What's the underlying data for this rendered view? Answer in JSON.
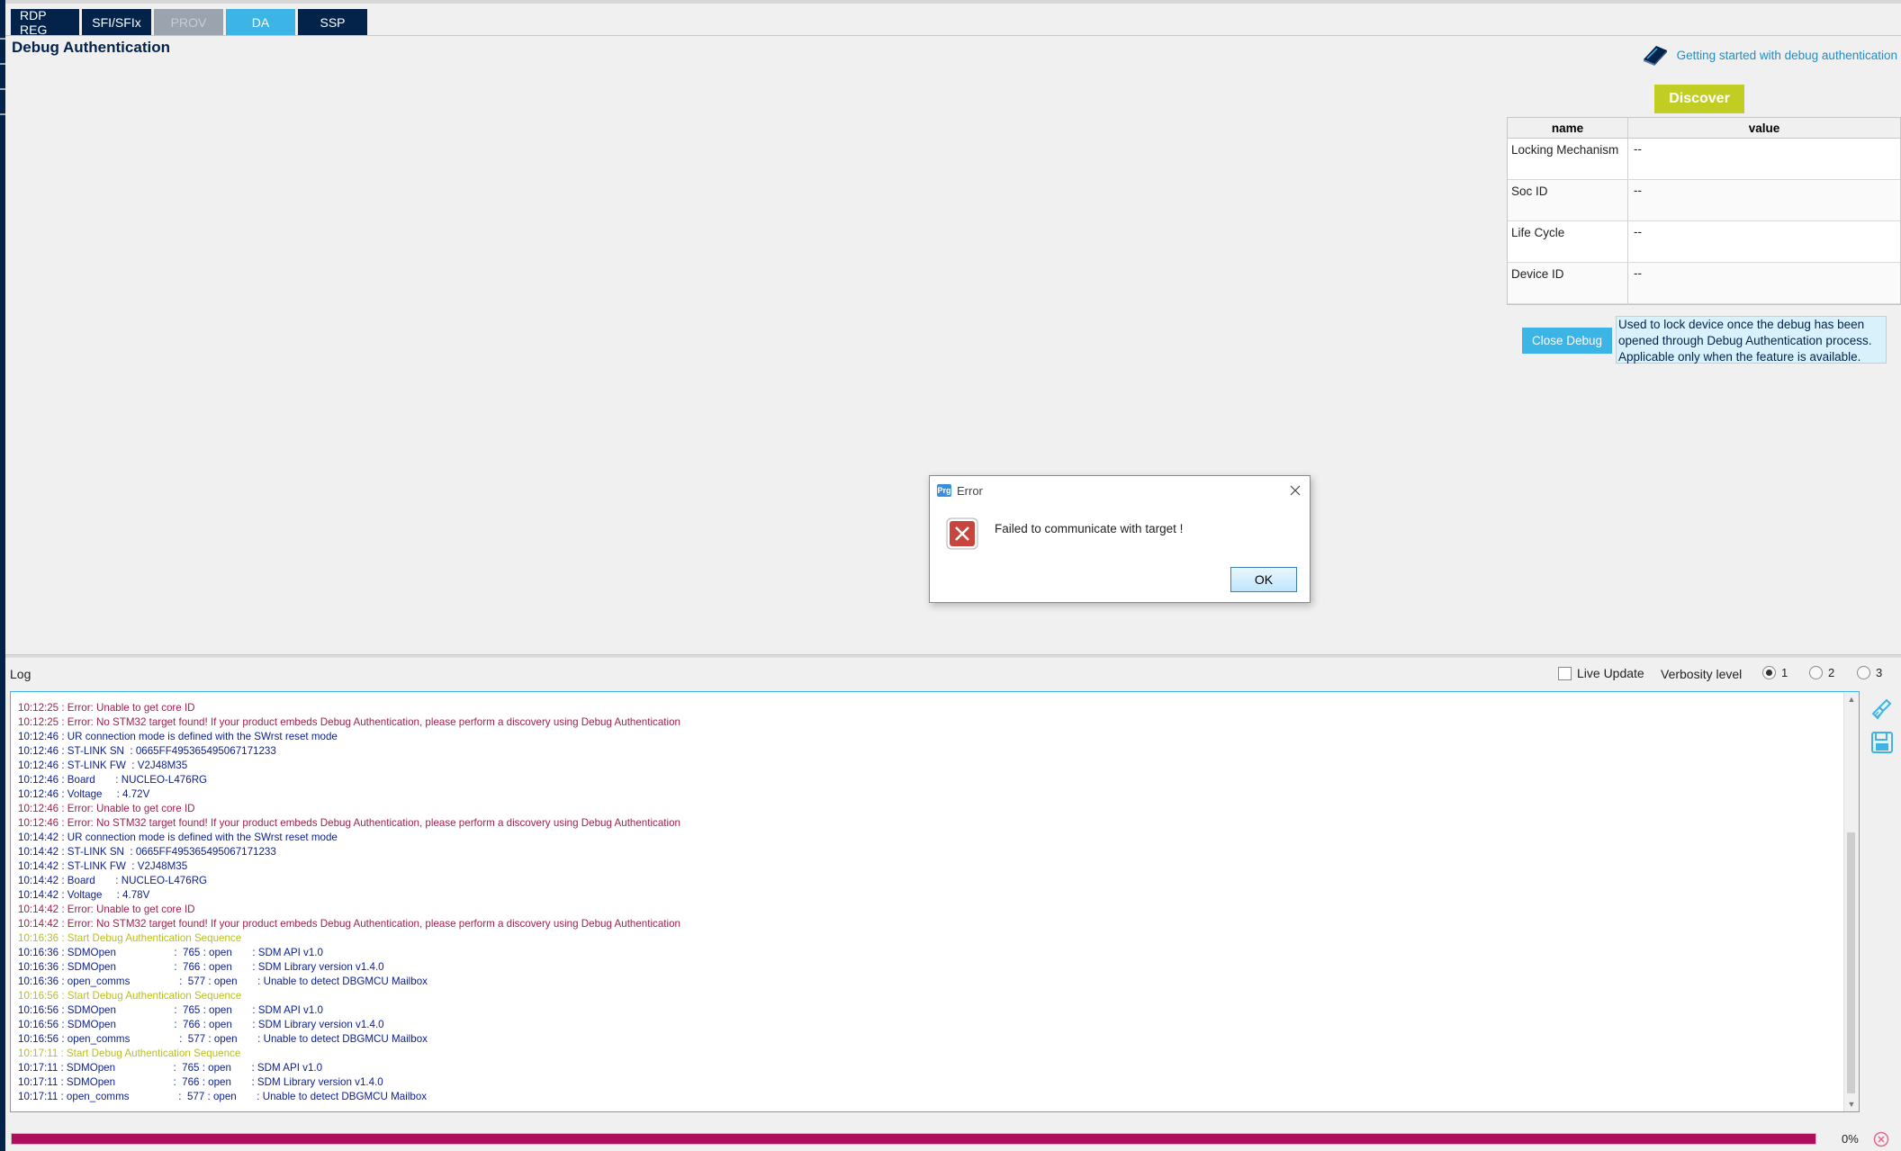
{
  "tabs": [
    {
      "label": "RDP REG"
    },
    {
      "label": "SFI/SFIx"
    },
    {
      "label": "PROV"
    },
    {
      "label": "DA"
    },
    {
      "label": "SSP"
    }
  ],
  "page": {
    "title": "Debug Authentication",
    "help_link": "Getting started with debug authentication",
    "discover_label": "Discover"
  },
  "properties_table": {
    "headers": [
      "name",
      "value"
    ],
    "rows": [
      {
        "name": "Locking Mechanism",
        "value": "--"
      },
      {
        "name": "Soc ID",
        "value": "--"
      },
      {
        "name": "Life Cycle",
        "value": "--"
      },
      {
        "name": "Device ID",
        "value": "--"
      }
    ]
  },
  "close_debug": {
    "label": "Close Debug",
    "tooltip": "Used to lock device once the debug has been opened through Debug Authentication process. Applicable only when the feature is available."
  },
  "dialog": {
    "app_icon": "Prg",
    "title": "Error",
    "message": "Failed to communicate with target !",
    "ok_label": "OK"
  },
  "log": {
    "label": "Log",
    "live_update_label": "Live Update",
    "live_update_checked": false,
    "verbosity_label": "Verbosity level",
    "verbosity_options": [
      "1",
      "2",
      "3"
    ],
    "verbosity_selected": "1",
    "lines": [
      {
        "t": "",
        "type": "clip"
      },
      {
        "t": "10:12:25 : Error: Unable to get core ID",
        "type": "error"
      },
      {
        "t": "10:12:25 : Error: No STM32 target found! If your product embeds Debug Authentication, please perform a discovery using Debug Authentication",
        "type": "error"
      },
      {
        "t": "10:12:46 : UR connection mode is defined with the SWrst reset mode",
        "type": "info"
      },
      {
        "t": "10:12:46 : ST-LINK SN  : 0665FF495365495067171233",
        "type": "info"
      },
      {
        "t": "10:12:46 : ST-LINK FW  : V2J48M35",
        "type": "info"
      },
      {
        "t": "10:12:46 : Board       : NUCLEO-L476RG",
        "type": "info"
      },
      {
        "t": "10:12:46 : Voltage     : 4.72V",
        "type": "info"
      },
      {
        "t": "10:12:46 : Error: Unable to get core ID",
        "type": "error"
      },
      {
        "t": "10:12:46 : Error: No STM32 target found! If your product embeds Debug Authentication, please perform a discovery using Debug Authentication",
        "type": "error"
      },
      {
        "t": "10:14:42 : UR connection mode is defined with the SWrst reset mode",
        "type": "info"
      },
      {
        "t": "10:14:42 : ST-LINK SN  : 0665FF495365495067171233",
        "type": "info"
      },
      {
        "t": "10:14:42 : ST-LINK FW  : V2J48M35",
        "type": "info"
      },
      {
        "t": "10:14:42 : Board       : NUCLEO-L476RG",
        "type": "info"
      },
      {
        "t": "10:14:42 : Voltage     : 4.78V",
        "type": "info"
      },
      {
        "t": "10:14:42 : Error: Unable to get core ID",
        "type": "error"
      },
      {
        "t": "10:14:42 : Error: No STM32 target found! If your product embeds Debug Authentication, please perform a discovery using Debug Authentication",
        "type": "error"
      },
      {
        "t": "10:16:36 : Start Debug Authentication Sequence",
        "type": "warn"
      },
      {
        "t": "10:16:36 : SDMOpen                    :  765 : open       : SDM API v1.0",
        "type": "info"
      },
      {
        "t": "10:16:36 : SDMOpen                    :  766 : open       : SDM Library version v1.4.0",
        "type": "info"
      },
      {
        "t": "10:16:36 : open_comms                 :  577 : open       : Unable to detect DBGMCU Mailbox",
        "type": "info"
      },
      {
        "t": "10:16:56 : Start Debug Authentication Sequence",
        "type": "warn"
      },
      {
        "t": "10:16:56 : SDMOpen                    :  765 : open       : SDM API v1.0",
        "type": "info"
      },
      {
        "t": "10:16:56 : SDMOpen                    :  766 : open       : SDM Library version v1.4.0",
        "type": "info"
      },
      {
        "t": "10:16:56 : open_comms                 :  577 : open       : Unable to detect DBGMCU Mailbox",
        "type": "info"
      },
      {
        "t": "10:17:11 : Start Debug Authentication Sequence",
        "type": "warn"
      },
      {
        "t": "10:17:11 : SDMOpen                    :  765 : open       : SDM API v1.0",
        "type": "info"
      },
      {
        "t": "10:17:11 : SDMOpen                    :  766 : open       : SDM Library version v1.4.0",
        "type": "info"
      },
      {
        "t": "10:17:11 : open_comms                 :  577 : open       : Unable to detect DBGMCU Mailbox",
        "type": "info"
      }
    ]
  },
  "progress": {
    "percent_label": "0%",
    "fill_fraction": 1.0
  },
  "colors": {
    "st_dark_blue": "#03234b",
    "st_light_blue": "#3cb4e6",
    "st_lime": "#c2cd23",
    "progress_magenta": "#ae0f5c",
    "log_error": "#a3214a",
    "log_info": "#0b1f8f",
    "log_sequence": "#b8c020"
  },
  "icons": {
    "help": "book-icon",
    "error": "error-x-icon",
    "dialog_close": "close-icon",
    "clear_log": "broom-icon",
    "save_log": "floppy-disk-icon",
    "cancel": "cancel-circle-icon"
  }
}
